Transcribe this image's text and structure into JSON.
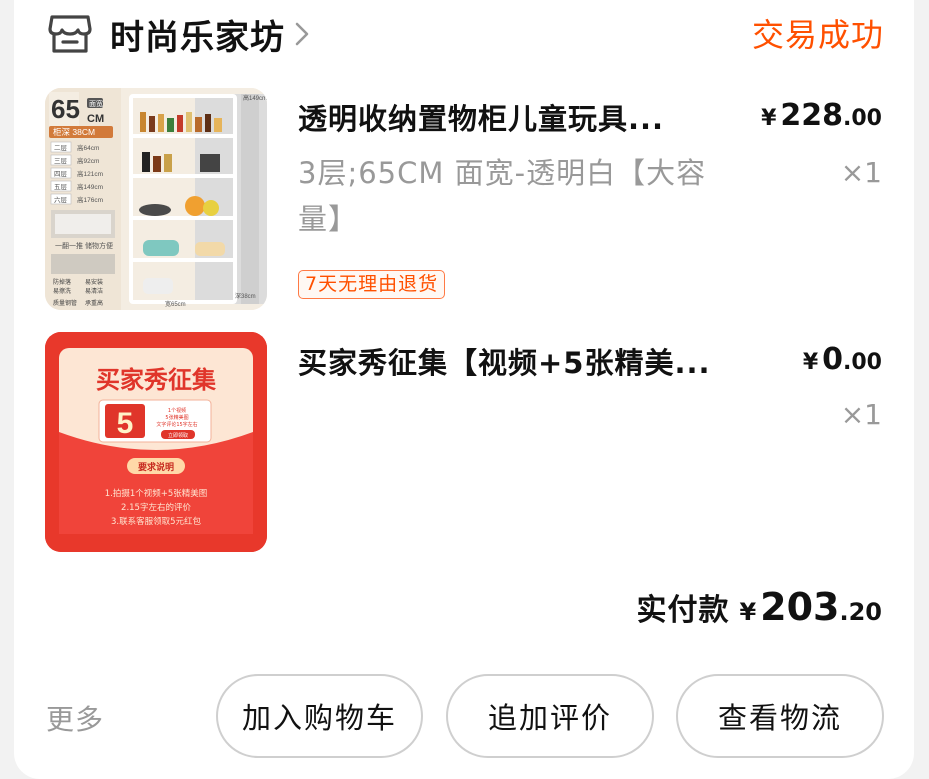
{
  "shop": {
    "name": "时尚乐家坊",
    "status": "交易成功"
  },
  "items": [
    {
      "title": "透明收纳置物柜儿童玩具...",
      "spec": "3层;65CM 面宽-透明白【大容量】",
      "price_currency": "¥",
      "price_int": "228",
      "price_dec": ".00",
      "qty": "×1",
      "tag": "7天无理由退货",
      "thumb": {
        "size_int": "65",
        "size_unit": "CM",
        "size_badge": "面宽",
        "depth_label": "柜深 38CM",
        "levels": [
          {
            "name": "二层",
            "height": "高64cm"
          },
          {
            "name": "三层",
            "height": "高92cm"
          },
          {
            "name": "四层",
            "height": "高121cm"
          },
          {
            "name": "五层",
            "height": "高149cm"
          },
          {
            "name": "六层",
            "height": "高176cm"
          }
        ],
        "caption": "一翻一推 储物方便",
        "features": [
          "防掉落",
          "易安装",
          "易擦洗",
          "易清洁",
          "质量钢管",
          "承重高"
        ],
        "dim_height": "高149cm",
        "dim_width": "宽65cm",
        "dim_depth": "深38cm"
      }
    },
    {
      "title": "买家秀征集【视频+5张精美...",
      "price_currency": "¥",
      "price_int": "0",
      "price_dec": ".00",
      "qty": "×1",
      "thumb": {
        "headline": "买家秀征集",
        "big_number": "5",
        "coupon_lines": [
          "1个视频",
          "5张精美图",
          "文字评论15字左右"
        ],
        "coupon_button": "立即领取",
        "req_title": "要求说明",
        "requirements": [
          "1.拍摄1个视频+5张精美图",
          "2.15字左右的评价",
          "3.联系客服领取5元红包"
        ]
      }
    }
  ],
  "payment": {
    "label": "实付款",
    "currency": "¥",
    "int": "203",
    "dec": ".20"
  },
  "actions": {
    "more": "更多",
    "add_to_cart": "加入购物车",
    "add_review": "追加评价",
    "view_logistics": "查看物流"
  },
  "colors": {
    "accent": "#ff5000",
    "muted": "#999999",
    "promo_red": "#e8382b"
  }
}
